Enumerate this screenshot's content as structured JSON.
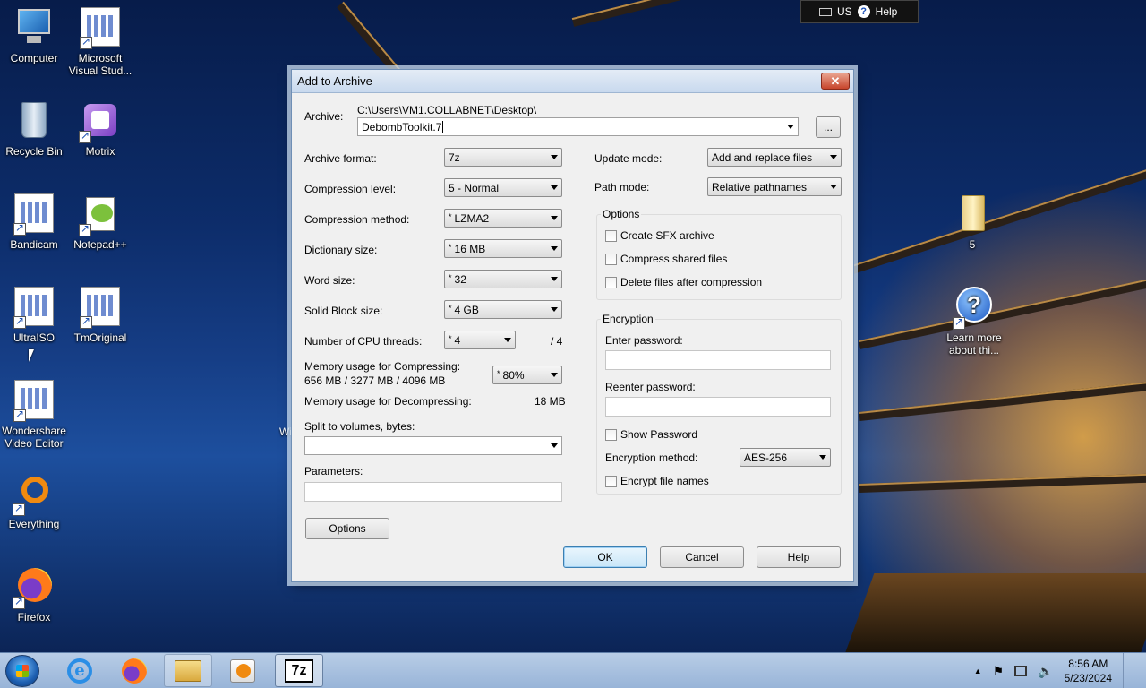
{
  "desktop": {
    "icons_left": [
      {
        "label": "Computer"
      },
      {
        "label": "Microsoft Visual Stud..."
      },
      {
        "label": "Recycle Bin"
      },
      {
        "label": "Motrix"
      },
      {
        "label": "Bandicam"
      },
      {
        "label": "Notepad++"
      },
      {
        "label": "UltraISO"
      },
      {
        "label": "TmOriginal"
      },
      {
        "label": "Wondershare Video Editor"
      },
      {
        "label": "Everything"
      },
      {
        "label": "Firefox"
      }
    ],
    "icons_right": [
      {
        "label": "5"
      },
      {
        "label": "Learn more about thi..."
      }
    ],
    "partial_label": "Wi"
  },
  "langbar": {
    "lang": "US",
    "help": "Help"
  },
  "dialog": {
    "title": "Add to Archive",
    "close_glyph": "✕",
    "archive_label": "Archive:",
    "archive_path": "C:\\Users\\VM1.COLLABNET\\Desktop\\",
    "archive_name": "DebombToolkit.7",
    "browse_label": "...",
    "left": {
      "archive_format": {
        "label": "Archive format:",
        "value": "7z"
      },
      "compression_level": {
        "label": "Compression level:",
        "value": "5 - Normal"
      },
      "compression_method": {
        "label": "Compression method:",
        "value": "LZMA2"
      },
      "dictionary_size": {
        "label": "Dictionary size:",
        "value": "16 MB"
      },
      "word_size": {
        "label": "Word size:",
        "value": "32"
      },
      "solid_block": {
        "label": "Solid Block size:",
        "value": "4 GB"
      },
      "cpu_threads": {
        "label": "Number of CPU threads:",
        "value": "4",
        "max": "/ 4"
      },
      "mem_compress": {
        "label": "Memory usage for Compressing:",
        "detail": "656 MB / 3277 MB / 4096 MB",
        "value": "80%"
      },
      "mem_decompress": {
        "label": "Memory usage for Decompressing:",
        "value": "18 MB"
      },
      "split": {
        "label": "Split to volumes, bytes:",
        "value": ""
      },
      "parameters": {
        "label": "Parameters:",
        "value": ""
      },
      "options_button": "Options"
    },
    "right": {
      "update_mode": {
        "label": "Update mode:",
        "value": "Add and replace files"
      },
      "path_mode": {
        "label": "Path mode:",
        "value": "Relative pathnames"
      },
      "options_group": "Options",
      "options": [
        {
          "label": "Create SFX archive",
          "checked": false
        },
        {
          "label": "Compress shared files",
          "checked": false
        },
        {
          "label": "Delete files after compression",
          "checked": false
        }
      ],
      "encryption_group": "Encryption",
      "enter_password": "Enter password:",
      "reenter_password": "Reenter password:",
      "show_password": "Show Password",
      "encryption_method": {
        "label": "Encryption method:",
        "value": "AES-256"
      },
      "encrypt_names": "Encrypt file names"
    },
    "buttons": {
      "ok": "OK",
      "cancel": "Cancel",
      "help": "Help"
    }
  },
  "taskbar": {
    "active_app": "7z",
    "clock_time": "8:56 AM",
    "clock_date": "5/23/2024"
  }
}
